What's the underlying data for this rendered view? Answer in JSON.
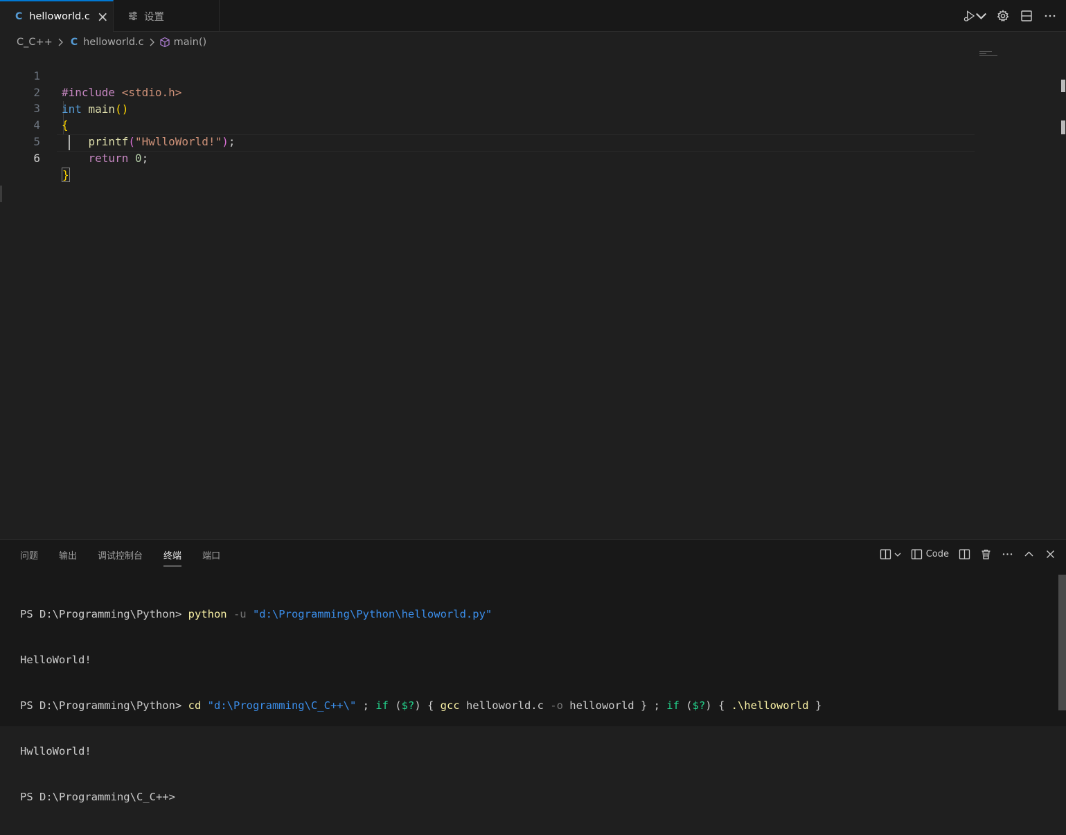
{
  "tabs": [
    {
      "label": "helloworld.c",
      "icon": "C",
      "active": true
    },
    {
      "label": "设置",
      "active": false
    }
  ],
  "breadcrumb": {
    "folder": "C_C++",
    "file_icon": "C",
    "file": "helloworld.c",
    "symbol": "main()"
  },
  "editor": {
    "line_numbers": [
      "1",
      "2",
      "3",
      "4",
      "5",
      "6"
    ],
    "current_line": 6,
    "lines": [
      [
        {
          "t": "#include ",
          "c": "dir"
        },
        {
          "t": "<stdio.h>",
          "c": "str"
        }
      ],
      [
        {
          "t": "int ",
          "c": "type"
        },
        {
          "t": "main",
          "c": "fn"
        },
        {
          "t": "()",
          "c": "brace"
        }
      ],
      [
        {
          "t": "{",
          "c": "brace"
        }
      ],
      [
        {
          "t": "    ",
          "c": "plain"
        },
        {
          "t": "printf",
          "c": "fn"
        },
        {
          "t": "(",
          "c": "paren"
        },
        {
          "t": "\"HwlloWorld!\"",
          "c": "str"
        },
        {
          "t": ")",
          "c": "paren"
        },
        {
          "t": ";",
          "c": "plain"
        }
      ],
      [
        {
          "t": "    ",
          "c": "plain"
        },
        {
          "t": "return ",
          "c": "ctl"
        },
        {
          "t": "0",
          "c": "num"
        },
        {
          "t": ";",
          "c": "plain"
        }
      ],
      [
        {
          "t": "}",
          "c": "brace"
        }
      ]
    ]
  },
  "panel": {
    "tabs": [
      "问题",
      "输出",
      "调试控制台",
      "终端",
      "端口"
    ],
    "active_tab": "终端",
    "terminal_profile_label": "Code",
    "terminal_lines": [
      [
        {
          "t": "PS D:\\Programming\\Python> ",
          "c": "plain"
        },
        {
          "t": "python",
          "c": "cmd"
        },
        {
          "t": " -u ",
          "c": "param"
        },
        {
          "t": "\"d:\\Programming\\Python\\helloworld.py\"",
          "c": "str"
        }
      ],
      [
        {
          "t": "HelloWorld!",
          "c": "plain"
        }
      ],
      [
        {
          "t": "PS D:\\Programming\\Python> ",
          "c": "plain"
        },
        {
          "t": "cd",
          "c": "cmd"
        },
        {
          "t": " ",
          "c": "plain"
        },
        {
          "t": "\"d:\\Programming\\C_C++\\\"",
          "c": "str"
        },
        {
          "t": " ; ",
          "c": "plain"
        },
        {
          "t": "if",
          "c": "kw"
        },
        {
          "t": " (",
          "c": "plain"
        },
        {
          "t": "$?",
          "c": "kw"
        },
        {
          "t": ") { ",
          "c": "plain"
        },
        {
          "t": "gcc",
          "c": "cmd"
        },
        {
          "t": " helloworld.c ",
          "c": "plain"
        },
        {
          "t": "-o",
          "c": "param"
        },
        {
          "t": " helloworld } ; ",
          "c": "plain"
        },
        {
          "t": "if",
          "c": "kw"
        },
        {
          "t": " (",
          "c": "plain"
        },
        {
          "t": "$?",
          "c": "kw"
        },
        {
          "t": ") { ",
          "c": "plain"
        },
        {
          "t": ".\\helloworld",
          "c": "cmd"
        },
        {
          "t": " }",
          "c": "plain"
        }
      ],
      [
        {
          "t": "HwlloWorld!",
          "c": "plain"
        }
      ],
      [
        {
          "t": "PS D:\\Programming\\C_C++>",
          "c": "plain"
        }
      ]
    ]
  },
  "colors": {
    "accent": "#0078d4",
    "editor_bg": "#1f1f1f",
    "chrome_bg": "#181818"
  },
  "icons": {
    "tab_bar_actions": [
      "run-debug-icon",
      "chevron-down-icon",
      "gear-icon",
      "split-editor-icon",
      "more-actions-icon"
    ],
    "panel_actions": [
      "new-terminal-layout-icon",
      "chevron-down-icon",
      "split-terminal-icon",
      "kill-terminal-icon",
      "more-actions-icon",
      "maximize-panel-icon",
      "close-panel-icon"
    ]
  }
}
